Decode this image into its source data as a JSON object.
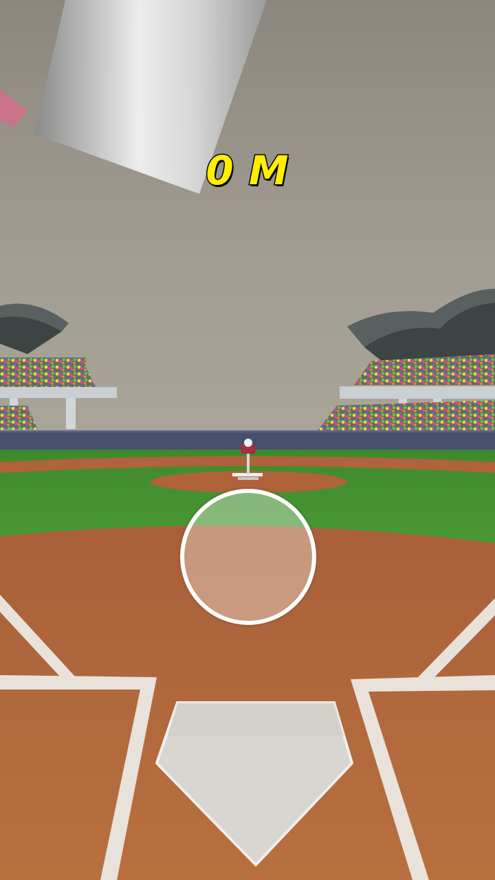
{
  "hud": {
    "distance_text": "0 M"
  },
  "colors": {
    "sky": "#8f8a80",
    "grass": "#3f8a2e",
    "dirt": "#b86a3a",
    "wall": "#46506e",
    "chalk": "#e8e2da",
    "distance_text": "#ffee00"
  },
  "icons": {
    "bat": "baseball-bat",
    "aim": "aim-ring",
    "pitcher": "pitching-machine"
  }
}
